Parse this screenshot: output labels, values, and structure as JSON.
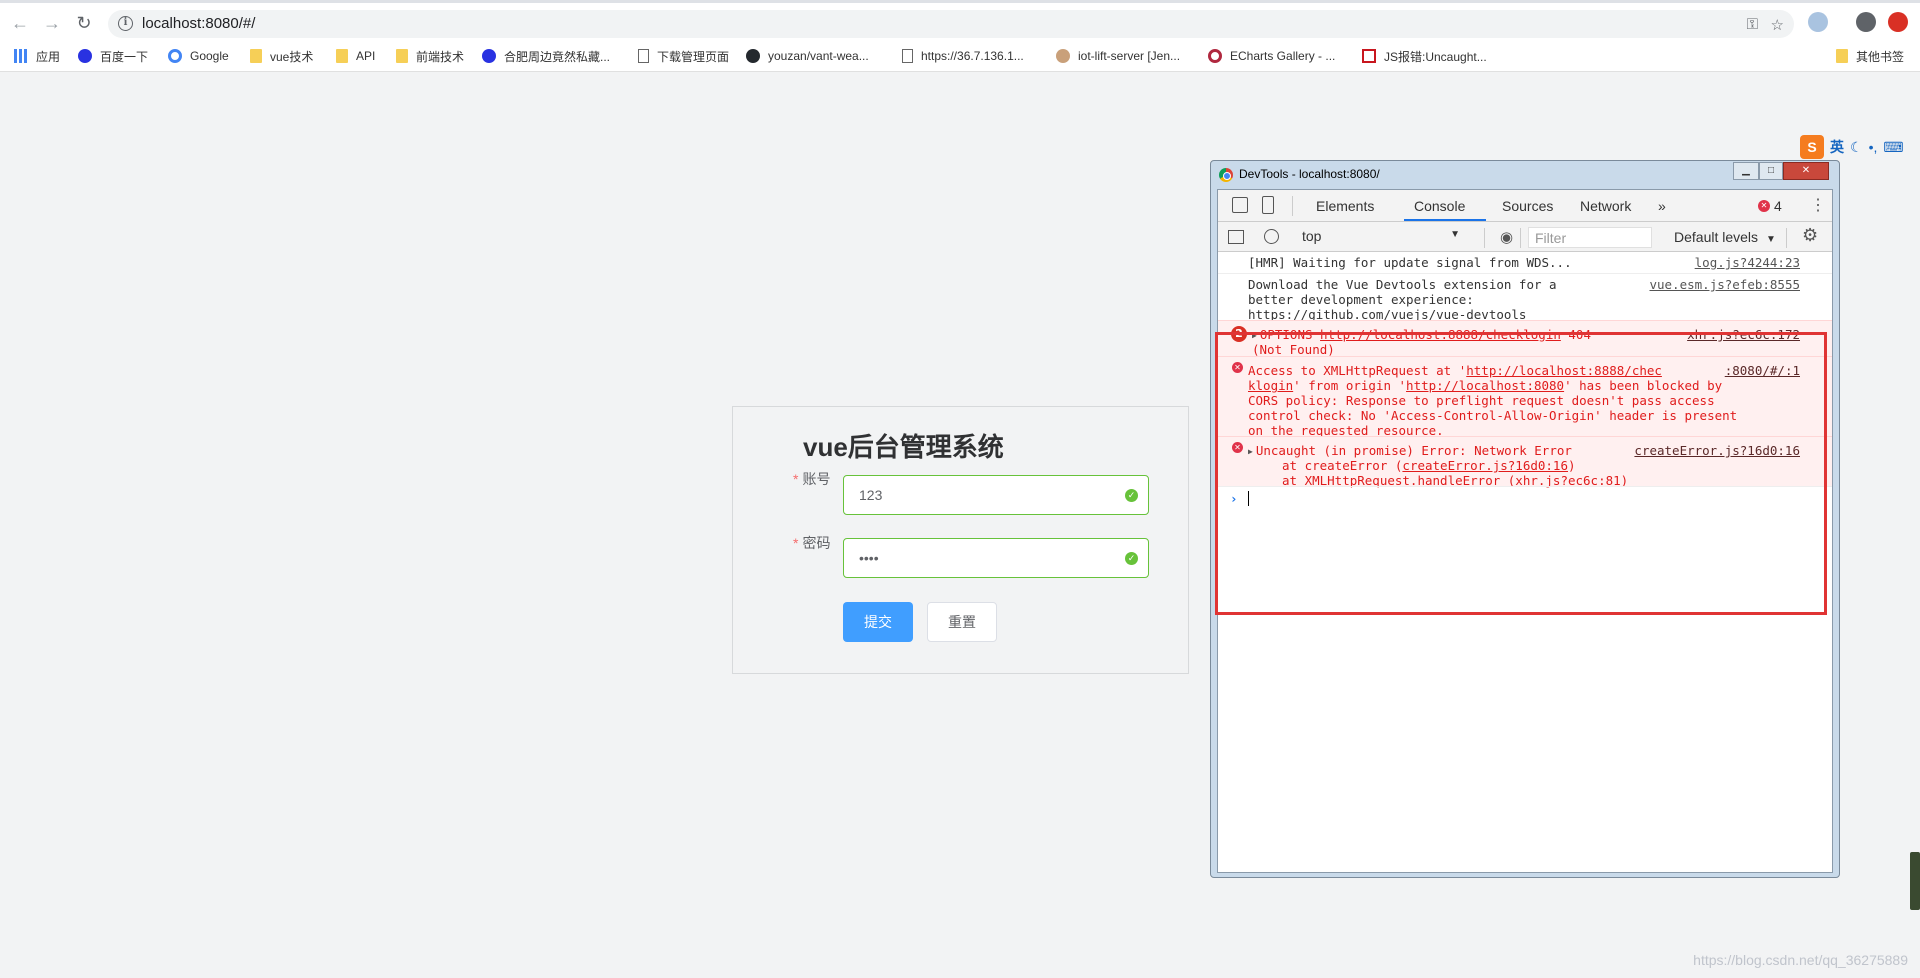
{
  "browser": {
    "url": "localhost:8080/#/",
    "bookmarks": [
      {
        "label": "应用",
        "icon": "apps-grid-icon"
      },
      {
        "label": "百度一下",
        "icon": "baidu-icon"
      },
      {
        "label": "Google",
        "icon": "google-icon"
      },
      {
        "label": "vue技术",
        "icon": "folder-icon"
      },
      {
        "label": "API",
        "icon": "folder-icon"
      },
      {
        "label": "前端技术",
        "icon": "folder-icon"
      },
      {
        "label": "合肥周边竟然私藏...",
        "icon": "baidu-icon"
      },
      {
        "label": "下载管理页面",
        "icon": "page-icon"
      },
      {
        "label": "youzan/vant-wea...",
        "icon": "github-icon"
      },
      {
        "label": "https://36.7.136.1...",
        "icon": "page-icon"
      },
      {
        "label": "iot-lift-server [Jen...",
        "icon": "jenkins-icon"
      },
      {
        "label": "ECharts Gallery - ...",
        "icon": "echarts-icon"
      },
      {
        "label": "JS报错:Uncaught...",
        "icon": "csdn-icon"
      },
      {
        "label": "其他书签",
        "icon": "folder-icon"
      }
    ]
  },
  "login": {
    "title": "vue后台管理系统",
    "account_label": "账号",
    "account_value": "123",
    "password_label": "密码",
    "password_value": "••••",
    "submit_label": "提交",
    "reset_label": "重置"
  },
  "devtools": {
    "window_title": "DevTools - localhost:8080/",
    "tabs": [
      "Elements",
      "Console",
      "Sources",
      "Network"
    ],
    "active_tab": "Console",
    "more_tabs": "»",
    "error_count": "4",
    "context": "top",
    "filter_placeholder": "Filter",
    "levels": "Default levels",
    "messages": {
      "hmr": {
        "text": "[HMR] Waiting for update signal from WDS...",
        "source": "log.js?4244:23"
      },
      "devtools": {
        "line1": "Download the Vue Devtools extension for a",
        "line2": "better development experience:",
        "link": "https://github.com/vuejs/vue-devtools",
        "source": "vue.esm.js?efeb:8555"
      },
      "options_error": {
        "count": "2",
        "method": "OPTIONS",
        "url": "http://localhost:8888/checklogin",
        "status": "404",
        "status2": "(Not Found)",
        "source": "xhr.js?ec6c:172"
      },
      "cors_error": {
        "l1a": "Access to XMLHttpRequest at '",
        "l1url": "http://localhost:8888/chec",
        "l2url": "klogin",
        "l2b": "' from origin '",
        "l2origin": "http://localhost:8080",
        "l2c": "' has been blocked by",
        "l3": "CORS policy: Response to preflight request doesn't pass access",
        "l4": "control check: No 'Access-Control-Allow-Origin' header is present",
        "l5": "on the requested resource.",
        "source": ":8080/#/:1"
      },
      "promise_error": {
        "l1": "Uncaught (in promise) Error: Network Error",
        "l2a": "at createError (",
        "l2link": "createError.js?16d0:16",
        "l2b": ")",
        "l3a": "at XMLHttpRequest.handleError (",
        "l3link": "xhr.js?ec6c:81",
        "l3b": ")",
        "source": "createError.js?16d0:16"
      }
    },
    "prompt": "›"
  },
  "ime": {
    "logo": "S",
    "lang": "英"
  },
  "watermark": "https://blog.csdn.net/qq_36275889"
}
